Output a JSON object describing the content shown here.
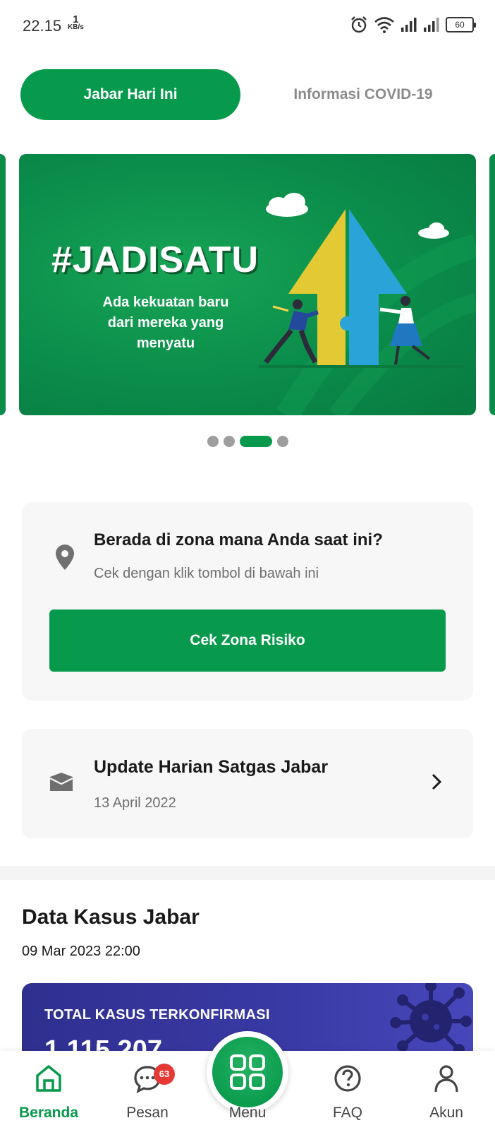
{
  "status_bar": {
    "time": "22.15",
    "speed_value": "1",
    "speed_unit": "KB/s",
    "battery": "60"
  },
  "tabs": {
    "active": "Jabar Hari Ini",
    "inactive": "Informasi COVID-19"
  },
  "banner": {
    "title": "#JADISATU",
    "subtitle": "Ada kekuatan baru dari mereka yang menyatu",
    "slide_count": 4,
    "active_slide": 3
  },
  "zone_card": {
    "title": "Berada di zona mana Anda saat ini?",
    "subtitle": "Cek dengan klik tombol di bawah ini",
    "button_label": "Cek Zona Risiko"
  },
  "update_card": {
    "title": "Update Harian Satgas Jabar",
    "date": "13 April 2022"
  },
  "data_kasus": {
    "title": "Data Kasus Jabar",
    "timestamp": "09 Mar 2023 22:00",
    "card_label": "TOTAL KASUS TERKONFIRMASI",
    "card_value": "1.115.207"
  },
  "bottom_nav": {
    "items": [
      {
        "label": "Beranda",
        "icon": "home-icon"
      },
      {
        "label": "Pesan",
        "icon": "chat-icon",
        "badge": "63"
      },
      {
        "label": "Menu",
        "icon": "grid-icon"
      },
      {
        "label": "FAQ",
        "icon": "help-icon"
      },
      {
        "label": "Akun",
        "icon": "user-icon"
      }
    ]
  },
  "colors": {
    "primary_green": "#079a4c",
    "card_blue": "#3a3aa6",
    "badge_red": "#e53935"
  }
}
